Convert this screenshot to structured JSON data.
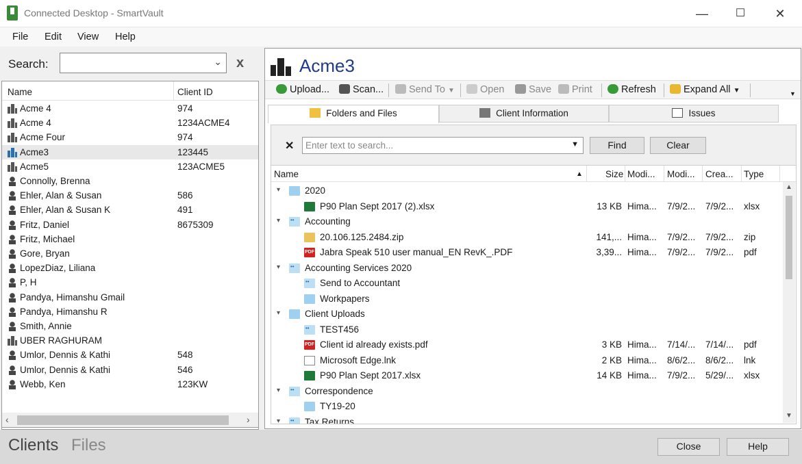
{
  "window": {
    "title": "Connected Desktop - SmartVault",
    "min": "—",
    "max": "☐",
    "close": "✕"
  },
  "menu": [
    "File",
    "Edit",
    "View",
    "Help"
  ],
  "left": {
    "search_label": "Search:",
    "search_value": "",
    "clear_glyph": "x",
    "columns": {
      "name": "Name",
      "client_id": "Client ID"
    },
    "clients": [
      {
        "name": "Acme 4",
        "id": "974",
        "type": "business"
      },
      {
        "name": "Acme 4",
        "id": "1234ACME4",
        "type": "business"
      },
      {
        "name": "Acme Four",
        "id": "974",
        "type": "business"
      },
      {
        "name": "Acme3",
        "id": "123445",
        "type": "business",
        "selected": true
      },
      {
        "name": "Acme5",
        "id": "123ACME5",
        "type": "business"
      },
      {
        "name": "Connolly, Brenna",
        "id": "",
        "type": "person"
      },
      {
        "name": "Ehler, Alan & Susan",
        "id": "586",
        "type": "person"
      },
      {
        "name": "Ehler, Alan & Susan K",
        "id": "491",
        "type": "person"
      },
      {
        "name": "Fritz, Daniel",
        "id": "8675309",
        "type": "person"
      },
      {
        "name": "Fritz, Michael",
        "id": "",
        "type": "person"
      },
      {
        "name": "Gore, Bryan",
        "id": "",
        "type": "person"
      },
      {
        "name": "LopezDiaz, Liliana",
        "id": "",
        "type": "person"
      },
      {
        "name": "P, H",
        "id": "",
        "type": "person"
      },
      {
        "name": "Pandya, Himanshu Gmail",
        "id": "",
        "type": "person"
      },
      {
        "name": "Pandya, Himanshu R",
        "id": "",
        "type": "person"
      },
      {
        "name": "Smith, Annie",
        "id": "",
        "type": "person"
      },
      {
        "name": "UBER RAGHURAM",
        "id": "",
        "type": "business"
      },
      {
        "name": "Umlor, Dennis & Kathi",
        "id": "548",
        "type": "person"
      },
      {
        "name": "Umlor, Dennis & Kathi",
        "id": "546",
        "type": "person"
      },
      {
        "name": "Webb, Ken",
        "id": "123KW",
        "type": "person"
      }
    ]
  },
  "right": {
    "client_name": "Acme3",
    "toolbar": [
      {
        "label": "Upload...",
        "icon": "upload-icon",
        "color": "#3a9a3a",
        "enabled": true
      },
      {
        "label": "Scan...",
        "icon": "scan-icon",
        "color": "#555555",
        "enabled": true
      },
      {
        "label": "Send To",
        "icon": "send-to-icon",
        "color": "#aaaaaa",
        "enabled": false,
        "dropdown": true
      },
      {
        "label": "Open",
        "icon": "open-icon",
        "color": "#bbbbbb",
        "enabled": false
      },
      {
        "label": "Save",
        "icon": "save-icon",
        "color": "#999999",
        "enabled": false
      },
      {
        "label": "Print",
        "icon": "print-icon",
        "color": "#aaaaaa",
        "enabled": false
      },
      {
        "label": "Refresh",
        "icon": "refresh-icon",
        "color": "#3a9a3a",
        "enabled": true
      },
      {
        "label": "Expand All",
        "icon": "expand-all-icon",
        "color": "#e8b830",
        "enabled": true,
        "dropdown": true
      }
    ],
    "tabs": [
      {
        "label": "Folders and Files",
        "icon": "folder-icon",
        "active": true
      },
      {
        "label": "Client Information",
        "icon": "client-info-icon",
        "active": false
      },
      {
        "label": "Issues",
        "icon": "issues-icon",
        "active": false
      }
    ],
    "find": {
      "placeholder": "Enter text to search...",
      "find_label": "Find",
      "clear_label": "Clear"
    },
    "grid_columns": {
      "name": "Name",
      "size": "Size",
      "modified_by": "Modi...",
      "modified": "Modi...",
      "created": "Crea...",
      "type": "Type"
    },
    "rows": [
      {
        "level": 0,
        "kind": "folder",
        "expanded": true,
        "name": "2020"
      },
      {
        "level": 1,
        "kind": "xlsx",
        "name": "P90 Plan Sept 2017 (2).xlsx",
        "size": "13 KB",
        "by": "Hima...",
        "mod": "7/9/2...",
        "cre": "7/9/2...",
        "type": "xlsx"
      },
      {
        "level": 0,
        "kind": "folder-shared",
        "expanded": true,
        "name": "Accounting"
      },
      {
        "level": 1,
        "kind": "zip",
        "name": "20.106.125.2484.zip",
        "size": "141,...",
        "by": "Hima...",
        "mod": "7/9/2...",
        "cre": "7/9/2...",
        "type": "zip"
      },
      {
        "level": 1,
        "kind": "pdf",
        "name": "Jabra Speak 510 user manual_EN RevK_.PDF",
        "size": "3,39...",
        "by": "Hima...",
        "mod": "7/9/2...",
        "cre": "7/9/2...",
        "type": "pdf"
      },
      {
        "level": 0,
        "kind": "folder-shared",
        "expanded": true,
        "name": "Accounting Services 2020"
      },
      {
        "level": 1,
        "kind": "folder-shared",
        "name": "Send to Accountant"
      },
      {
        "level": 1,
        "kind": "folder",
        "name": "Workpapers"
      },
      {
        "level": 0,
        "kind": "folder",
        "expanded": true,
        "name": "Client Uploads"
      },
      {
        "level": 1,
        "kind": "folder-shared",
        "name": "TEST456"
      },
      {
        "level": 1,
        "kind": "pdf",
        "name": "Client id already exists.pdf",
        "size": "3 KB",
        "by": "Hima...",
        "mod": "7/14/...",
        "cre": "7/14/...",
        "type": "pdf"
      },
      {
        "level": 1,
        "kind": "lnk",
        "name": "Microsoft Edge.lnk",
        "size": "2 KB",
        "by": "Hima...",
        "mod": "8/6/2...",
        "cre": "8/6/2...",
        "type": "lnk"
      },
      {
        "level": 1,
        "kind": "xlsx",
        "name": "P90 Plan Sept 2017.xlsx",
        "size": "14 KB",
        "by": "Hima...",
        "mod": "7/9/2...",
        "cre": "5/29/...",
        "type": "xlsx"
      },
      {
        "level": 0,
        "kind": "folder-shared",
        "expanded": true,
        "name": "Correspondence"
      },
      {
        "level": 1,
        "kind": "folder",
        "name": "TY19-20"
      },
      {
        "level": 0,
        "kind": "folder-shared",
        "expanded": true,
        "name": "Tax Returns"
      }
    ]
  },
  "bottom": {
    "tabs": [
      {
        "label": "Clients",
        "active": true
      },
      {
        "label": "Files",
        "active": false
      }
    ],
    "close_label": "Close",
    "help_label": "Help"
  }
}
